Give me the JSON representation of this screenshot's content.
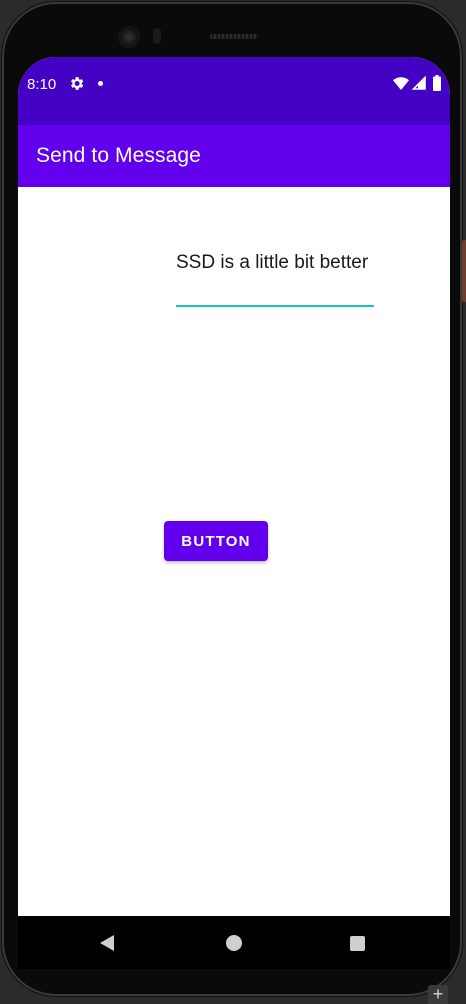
{
  "status_bar": {
    "time": "8:10",
    "icons": [
      "gear-icon",
      "notification-dot-icon",
      "wifi-icon",
      "cellular-signal-icon",
      "battery-icon"
    ]
  },
  "app_bar": {
    "title": "Send to Message"
  },
  "main": {
    "message_field": {
      "value": "SSD is a little bit better"
    },
    "button": {
      "label": "BUTTON"
    }
  },
  "nav_bar": {
    "icons": [
      "back-icon",
      "home-icon",
      "recents-icon"
    ]
  },
  "emulator": {
    "corner_control": "+"
  },
  "colors": {
    "status_bar": "#4402c4",
    "primary": "#6200ee",
    "field_underline": "#19c2c2",
    "content_background": "#ffffff",
    "nav_bar": "#000000"
  }
}
